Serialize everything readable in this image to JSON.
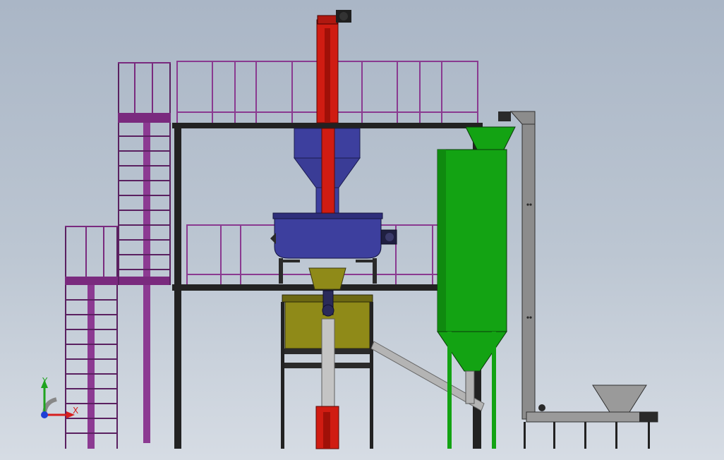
{
  "triad": {
    "x_label": "X",
    "y_label": "Y",
    "x_color": "#d61f1f",
    "y_color": "#1fa31f",
    "z_color": "#1f3fd6"
  },
  "colors": {
    "frame": "#202020",
    "rail": "#7a2a7e",
    "elevator": "#d01c12",
    "mixer": "#3a3a9c",
    "silo": "#13a313",
    "hopper_olive": "#8f8a18",
    "conveyor": "#8a8a8a",
    "pipe_gray": "#b4b4b4"
  }
}
